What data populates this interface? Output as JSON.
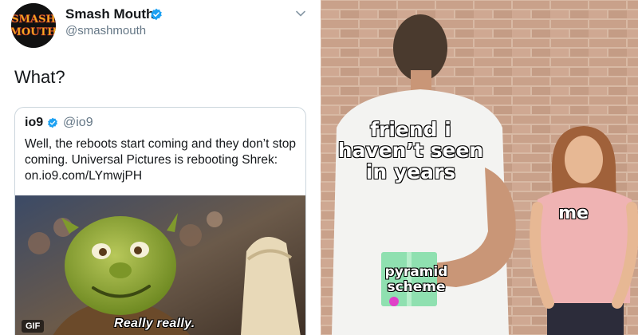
{
  "tweet": {
    "author_name": "Smash Mouth",
    "author_handle": "@smashmouth",
    "avatar_logo_text": "SMASH MOUTH",
    "text": "What?",
    "quoted": {
      "author_name": "io9",
      "author_handle": "@io9",
      "text": "Well, the reboots start coming and they don’t stop coming. Universal Pictures is rebooting Shrek: on.io9.com/LYmwjPH",
      "media": {
        "badge": "GIF",
        "subtitle": "Really really."
      }
    }
  },
  "meme": {
    "labels": {
      "friend": "friend i haven’t seen in years",
      "me": "me",
      "gift": "pyramid scheme"
    }
  },
  "colors": {
    "text_primary": "#14171a",
    "text_secondary": "#657786",
    "verified_blue": "#1da1f2",
    "card_border": "#ccd6dd",
    "shrek_green": "#8fa43a",
    "gift_green": "#8fe0b0",
    "brick": "#c9a48e"
  },
  "icons": {
    "verified": "verified-badge-icon",
    "caret": "chevron-down-icon"
  }
}
